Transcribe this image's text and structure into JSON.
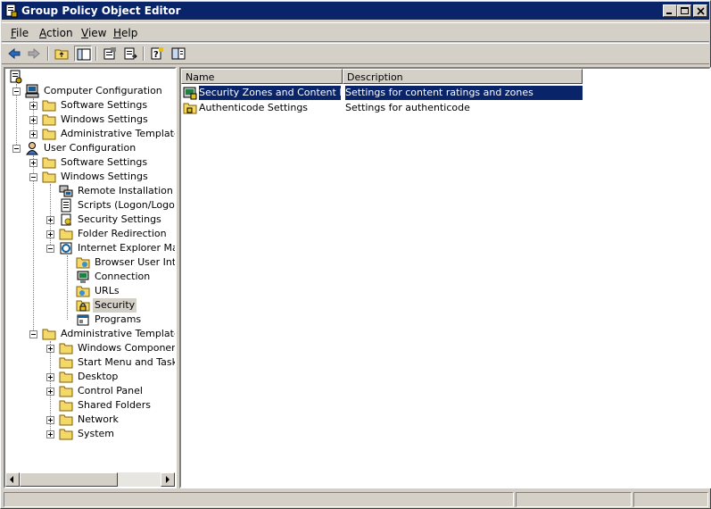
{
  "window": {
    "title": "Group Policy Object Editor"
  },
  "menu": [
    {
      "u": "F",
      "rest": "ile"
    },
    {
      "u": "A",
      "rest": "ction"
    },
    {
      "u": "V",
      "rest": "iew"
    },
    {
      "u": "H",
      "rest": "elp"
    }
  ],
  "toolbar": {
    "icons": [
      "back-arrow-icon",
      "forward-arrow-icon",
      "up-folder-icon",
      "show-hide-tree-icon",
      "properties-icon",
      "export-list-icon",
      "help-icon",
      "show-hide-action-pane-icon"
    ]
  },
  "tree": {
    "root_icon": "policy-root-icon",
    "items": [
      {
        "label": "Computer Configuration"
      },
      {
        "label": "Software Settings"
      },
      {
        "label": "Windows Settings"
      },
      {
        "label": "Administrative Templates"
      },
      {
        "label": "User Configuration"
      },
      {
        "label": "Software Settings"
      },
      {
        "label": "Windows Settings"
      },
      {
        "label": "Remote Installation Services"
      },
      {
        "label": "Scripts (Logon/Logoff)"
      },
      {
        "label": "Security Settings"
      },
      {
        "label": "Folder Redirection"
      },
      {
        "label": "Internet Explorer Maintenance"
      },
      {
        "label": "Browser User Interface"
      },
      {
        "label": "Connection"
      },
      {
        "label": "URLs"
      },
      {
        "label": "Security",
        "selected": true
      },
      {
        "label": "Programs"
      },
      {
        "label": "Administrative Templates"
      },
      {
        "label": "Windows Components"
      },
      {
        "label": "Start Menu and Taskbar"
      },
      {
        "label": "Desktop"
      },
      {
        "label": "Control Panel"
      },
      {
        "label": "Shared Folders"
      },
      {
        "label": "Network"
      },
      {
        "label": "System"
      }
    ]
  },
  "list": {
    "columns": [
      "Name",
      "Description"
    ],
    "rows": [
      {
        "name": "Security Zones and Content R...",
        "description": "Settings for content ratings and zones",
        "selected": true
      },
      {
        "name": "Authenticode Settings",
        "description": "Settings for authenticode",
        "selected": false
      }
    ]
  },
  "colors": {
    "titlebar": "#0a246a",
    "face": "#d4d0c8",
    "selection": "#0a246a"
  }
}
